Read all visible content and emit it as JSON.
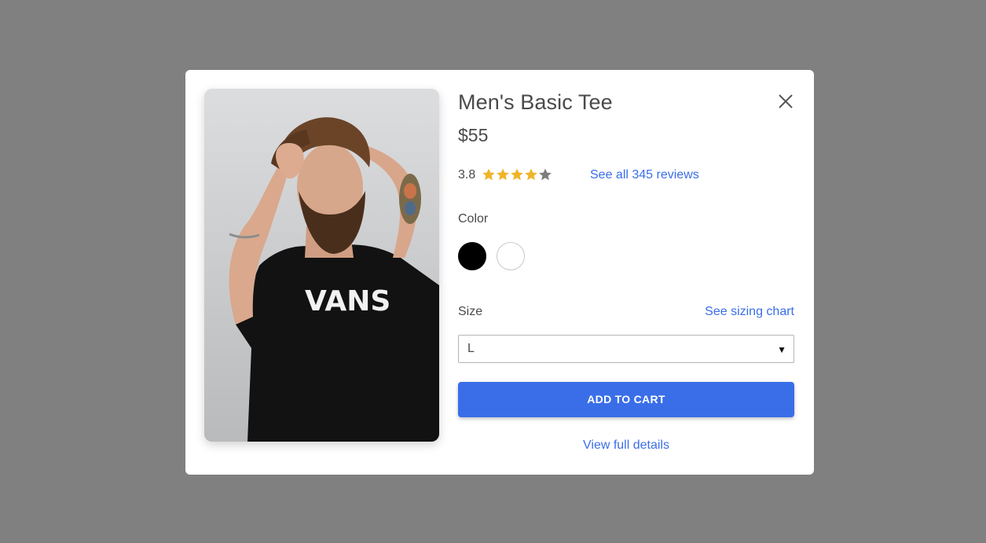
{
  "product": {
    "title": "Men's Basic Tee",
    "price": "$55",
    "image": {
      "description_icon": "product-photo",
      "shirt_print": "VANS"
    }
  },
  "rating": {
    "value": "3.8",
    "out_of": 5,
    "filled_stars": 4,
    "star_color": "#f0b429",
    "empty_star_color": "#7d7d7d",
    "reviews_link": "See all 345 reviews"
  },
  "color": {
    "label": "Color",
    "options": [
      {
        "name": "black",
        "hex": "#000000"
      },
      {
        "name": "white",
        "hex": "#ffffff"
      }
    ]
  },
  "size": {
    "label": "Size",
    "chart_link": "See sizing chart",
    "selected": "L",
    "caret": "▼"
  },
  "actions": {
    "add_to_cart": "ADD TO CART",
    "view_details": "View full details"
  },
  "colors": {
    "accent": "#3a6ee8",
    "overlay": "#808080",
    "text": "#4a4a4a"
  }
}
